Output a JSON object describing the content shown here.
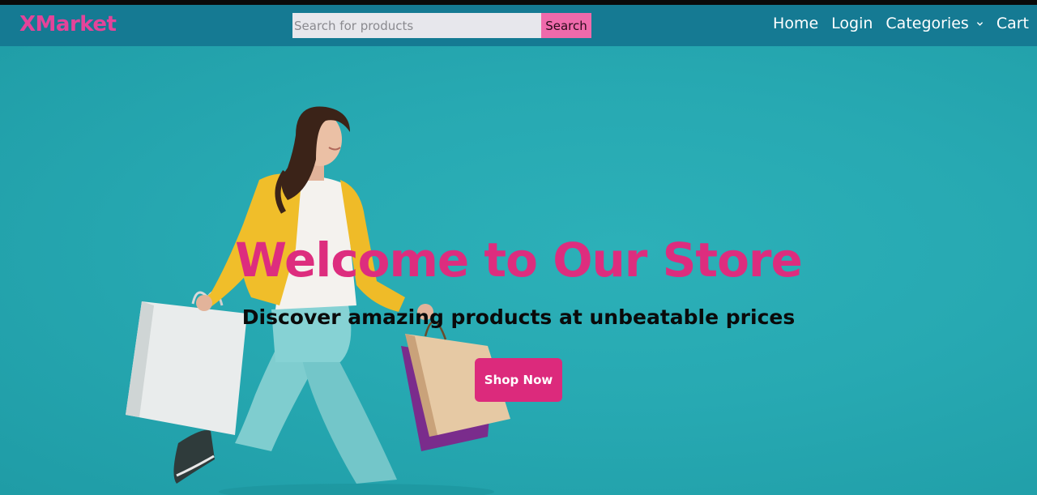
{
  "brand": {
    "name": "XMarket"
  },
  "search": {
    "placeholder": "Search for products",
    "value": "",
    "button_label": "Search"
  },
  "nav": {
    "items": [
      {
        "label": "Home"
      },
      {
        "label": "Login"
      },
      {
        "label": "Categories",
        "icon": "chevron-down-icon"
      },
      {
        "label": "Cart"
      }
    ]
  },
  "hero": {
    "title": "Welcome to Our Store",
    "subtitle": "Discover amazing products at unbeatable prices",
    "cta_label": "Shop Now"
  },
  "colors": {
    "navbar": "#157a93",
    "hero_bg": "#27a9b2",
    "accent_pink": "#dc2a7c",
    "search_button": "#ef6aab"
  }
}
